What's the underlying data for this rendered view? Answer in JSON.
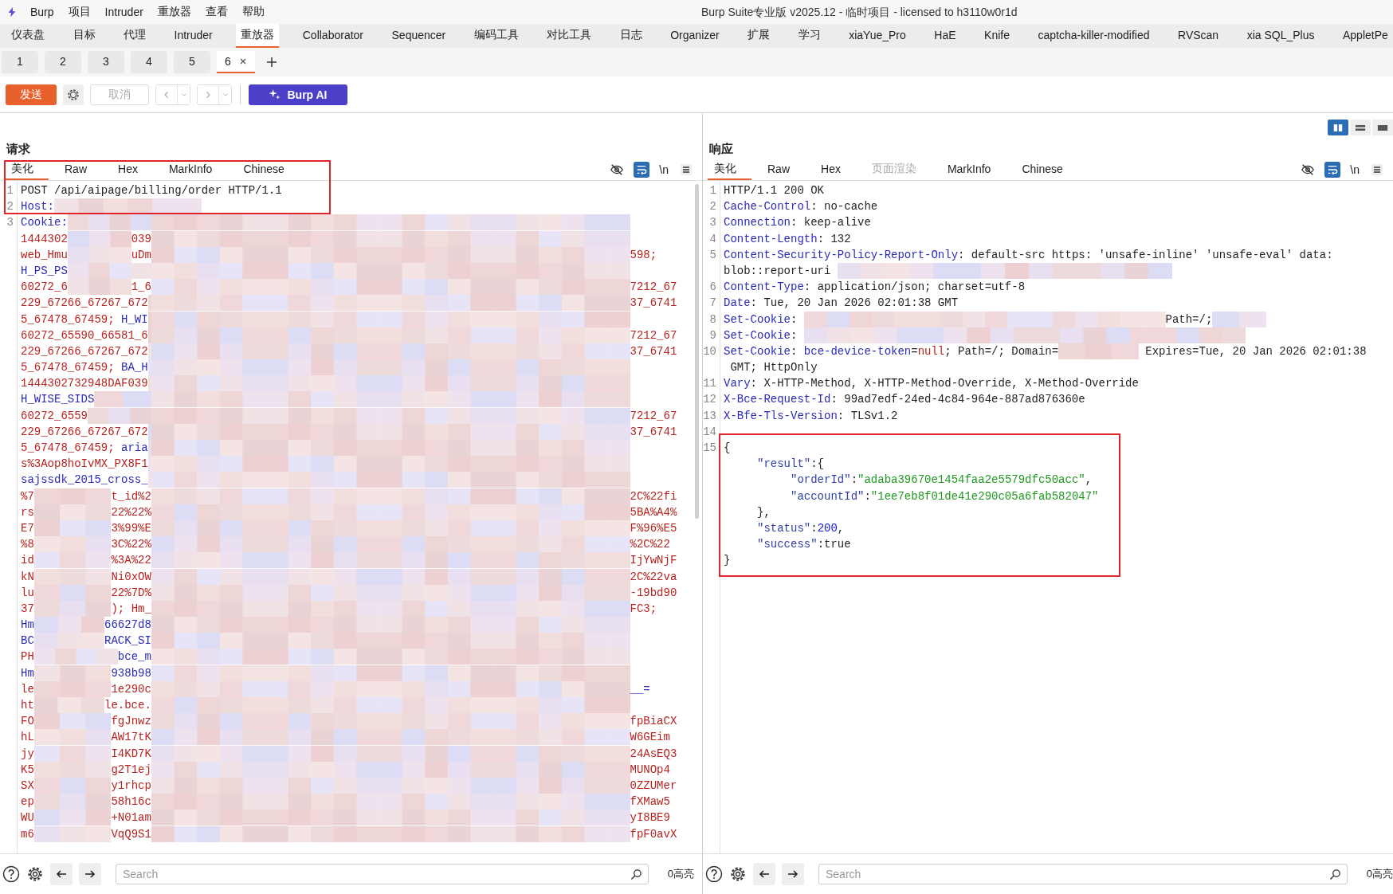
{
  "title_bar": {
    "menus": [
      "Burp",
      "项目",
      "Intruder",
      "重放器",
      "查看",
      "帮助"
    ],
    "title": "Burp Suite专业版  v2025.12 - 临时项目 - licensed to h3110w0r1d"
  },
  "main_tabs": [
    {
      "label": "仪表盘",
      "selected": false
    },
    {
      "label": "目标",
      "selected": false
    },
    {
      "label": "代理",
      "selected": false
    },
    {
      "label": "Intruder",
      "selected": false
    },
    {
      "label": "重放器",
      "selected": true
    },
    {
      "label": "Collaborator",
      "selected": false
    },
    {
      "label": "Sequencer",
      "selected": false
    },
    {
      "label": "编码工具",
      "selected": false
    },
    {
      "label": "对比工具",
      "selected": false
    },
    {
      "label": "日志",
      "selected": false
    },
    {
      "label": "Organizer",
      "selected": false
    },
    {
      "label": "扩展",
      "selected": false
    },
    {
      "label": "学习",
      "selected": false
    },
    {
      "label": "xiaYue_Pro",
      "selected": false
    },
    {
      "label": "HaE",
      "selected": false
    },
    {
      "label": "Knife",
      "selected": false
    },
    {
      "label": "captcha-killer-modified",
      "selected": false
    },
    {
      "label": "RVScan",
      "selected": false
    },
    {
      "label": "xia SQL_Plus",
      "selected": false
    },
    {
      "label": "AppletPe",
      "selected": false
    }
  ],
  "request_tabs": [
    {
      "label": "1",
      "selected": false
    },
    {
      "label": "2",
      "selected": false
    },
    {
      "label": "3",
      "selected": false
    },
    {
      "label": "4",
      "selected": false
    },
    {
      "label": "5",
      "selected": false
    },
    {
      "label": "6",
      "selected": true
    }
  ],
  "toolbar": {
    "send": "发送",
    "cancel": {
      "label": "取消",
      "disabled": true
    },
    "ai": "Burp AI"
  },
  "layout_toggles": [
    {
      "kind": "columns",
      "selected": true
    },
    {
      "kind": "rows",
      "selected": false
    },
    {
      "kind": "single",
      "selected": false
    }
  ],
  "request": {
    "title": "请求",
    "annotation_box": true,
    "wrap_on": true,
    "newline_label": "\\n",
    "tabs": [
      {
        "label": "美化",
        "selected": true,
        "disabled": false
      },
      {
        "label": "Raw",
        "selected": false,
        "disabled": false
      },
      {
        "label": "Hex",
        "selected": false,
        "disabled": false
      },
      {
        "label": "MarkInfo",
        "selected": false,
        "disabled": false
      },
      {
        "label": "Chinese",
        "selected": false,
        "disabled": false
      }
    ],
    "lines": [
      {
        "num": "1",
        "kind": "plain",
        "parts": [
          {
            "text": "POST /api/aipage/billing/order HTTP/1.1",
            "kind": "plain"
          }
        ]
      },
      {
        "num": "2",
        "kind": "short",
        "parts": [
          {
            "text": "Host:",
            "kind": "name"
          }
        ]
      },
      {
        "num": "3",
        "kind": "full",
        "parts": [
          {
            "text": "Cookie:",
            "kind": "name"
          }
        ]
      },
      {
        "kind": "full",
        "parts": [
          {
            "text": "1444302",
            "kind": "value"
          }
        ],
        "middle": {
          "text": "039",
          "kind": "value"
        }
      },
      {
        "kind": "full",
        "parts": [
          {
            "text": "web_Hmu",
            "kind": "value"
          }
        ],
        "middle": {
          "text": "uDm",
          "kind": "value"
        },
        "suffix": {
          "text": "598;",
          "kind": "value"
        }
      },
      {
        "kind": "full",
        "parts": [
          {
            "text": "H_PS_PS",
            "kind": "name"
          }
        ]
      },
      {
        "kind": "full",
        "parts": [
          {
            "text": "60272_6",
            "kind": "value"
          }
        ],
        "middle": {
          "text": "1_6",
          "kind": "value"
        },
        "suffix": {
          "text": "7212_67",
          "kind": "value"
        }
      },
      {
        "kind": "full",
        "parts": [
          {
            "text": "229_67266_67267_672",
            "kind": "value"
          }
        ],
        "suffix": {
          "text": "37_6741",
          "kind": "value"
        }
      },
      {
        "kind": "full",
        "parts": [
          {
            "text": "5_67478_67459; ",
            "kind": "value"
          },
          {
            "text": "H_WI",
            "kind": "name"
          }
        ]
      },
      {
        "kind": "full",
        "parts": [
          {
            "text": "60272_65590_66581_6",
            "kind": "value"
          }
        ],
        "suffix": {
          "text": "7212_67",
          "kind": "value"
        }
      },
      {
        "kind": "full",
        "parts": [
          {
            "text": "229_67266_67267_672",
            "kind": "value"
          }
        ],
        "suffix": {
          "text": "37_6741",
          "kind": "value"
        }
      },
      {
        "kind": "full",
        "parts": [
          {
            "text": "5_67478_67459; ",
            "kind": "value"
          },
          {
            "text": "BA_H",
            "kind": "name"
          }
        ]
      },
      {
        "kind": "full",
        "parts": [
          {
            "text": "1444302732948DAF039",
            "kind": "value"
          }
        ]
      },
      {
        "kind": "full",
        "parts": [
          {
            "text": "H_WISE_SIDS",
            "kind": "name"
          }
        ]
      },
      {
        "kind": "full",
        "parts": [
          {
            "text": "60272_6559",
            "kind": "value"
          }
        ],
        "suffix": {
          "text": "7212_67",
          "kind": "value"
        }
      },
      {
        "kind": "full",
        "parts": [
          {
            "text": "229_67266_67267_672",
            "kind": "value"
          }
        ],
        "suffix": {
          "text": "37_6741",
          "kind": "value"
        }
      },
      {
        "kind": "full",
        "parts": [
          {
            "text": "5_67478_67459; ",
            "kind": "value"
          },
          {
            "text": "aria",
            "kind": "name"
          }
        ]
      },
      {
        "kind": "full",
        "parts": [
          {
            "text": "s%3Aop8hoIvMX_PX8F1",
            "kind": "value"
          }
        ]
      },
      {
        "kind": "full",
        "parts": [
          {
            "text": "sajssdk_2015_cross_",
            "kind": "name"
          }
        ]
      },
      {
        "kind": "full",
        "parts": [
          {
            "text": "%7",
            "kind": "value"
          }
        ],
        "middle": {
          "text": "t_id%2",
          "kind": "value"
        },
        "suffix": {
          "text": "2C%22fi",
          "kind": "value"
        }
      },
      {
        "kind": "full",
        "parts": [
          {
            "text": "rs",
            "kind": "value"
          }
        ],
        "middle": {
          "text": "22%22%",
          "kind": "value"
        },
        "suffix": {
          "text": "5BA%A4%",
          "kind": "value"
        }
      },
      {
        "kind": "full",
        "parts": [
          {
            "text": "E7",
            "kind": "value"
          }
        ],
        "middle": {
          "text": "3%99%E",
          "kind": "value"
        },
        "suffix": {
          "text": "F%96%E5",
          "kind": "value"
        }
      },
      {
        "kind": "full",
        "parts": [
          {
            "text": "%8",
            "kind": "value"
          }
        ],
        "middle": {
          "text": "3C%22%",
          "kind": "value"
        },
        "suffix": {
          "text": "%2C%22",
          "kind": "value"
        }
      },
      {
        "kind": "full",
        "parts": [
          {
            "text": "id",
            "kind": "value"
          }
        ],
        "middle": {
          "text": "%3A%22",
          "kind": "value"
        },
        "suffix": {
          "text": "IjYwNjF",
          "kind": "value"
        }
      },
      {
        "kind": "full",
        "parts": [
          {
            "text": "kN",
            "kind": "value"
          }
        ],
        "middle": {
          "text": "Ni0xOW",
          "kind": "value"
        },
        "suffix": {
          "text": "2C%22va",
          "kind": "value"
        }
      },
      {
        "kind": "full",
        "parts": [
          {
            "text": "lu",
            "kind": "value"
          }
        ],
        "middle": {
          "text": "22%7D%",
          "kind": "value"
        },
        "suffix": {
          "text": "-19bd90",
          "kind": "value"
        }
      },
      {
        "kind": "full",
        "parts": [
          {
            "text": "37",
            "kind": "value"
          }
        ],
        "middle": {
          "text": "); Hm_",
          "kind": "value"
        },
        "suffix": {
          "text": "FC3;",
          "kind": "value"
        }
      },
      {
        "kind": "full",
        "parts": [
          {
            "text": "Hm",
            "kind": "name"
          }
        ],
        "middle": {
          "text": "66627d8",
          "kind": "name"
        }
      },
      {
        "kind": "full",
        "parts": [
          {
            "text": "BC",
            "kind": "name"
          }
        ],
        "middle": {
          "text": "RACK_SI",
          "kind": "name"
        }
      },
      {
        "kind": "full",
        "parts": [
          {
            "text": "PH",
            "kind": "value"
          }
        ],
        "middle": {
          "text": "bce_m",
          "kind": "name"
        }
      },
      {
        "kind": "full",
        "parts": [
          {
            "text": "Hm",
            "kind": "name"
          }
        ],
        "middle": {
          "text": "938b98",
          "kind": "name"
        }
      },
      {
        "kind": "full",
        "parts": [
          {
            "text": "le",
            "kind": "value"
          }
        ],
        "middle": {
          "text": "1e290c",
          "kind": "value"
        },
        "suffix": {
          "text": "__=",
          "kind": "name"
        }
      },
      {
        "kind": "full",
        "parts": [
          {
            "text": "ht",
            "kind": "value"
          }
        ],
        "middle": {
          "text": "le.bce.",
          "kind": "value"
        }
      },
      {
        "kind": "full",
        "parts": [
          {
            "text": "FO",
            "kind": "value"
          }
        ],
        "middle": {
          "text": "fgJnwz",
          "kind": "value"
        },
        "suffix": {
          "text": "fpBiaCX",
          "kind": "value"
        }
      },
      {
        "kind": "full",
        "parts": [
          {
            "text": "hL",
            "kind": "value"
          }
        ],
        "middle": {
          "text": "AW17tK",
          "kind": "value"
        },
        "suffix": {
          "text": "W6GEim",
          "kind": "value"
        }
      },
      {
        "kind": "full",
        "parts": [
          {
            "text": "jy",
            "kind": "value"
          }
        ],
        "middle": {
          "text": "I4KD7K",
          "kind": "value"
        },
        "suffix": {
          "text": "24AsEQ3",
          "kind": "value"
        }
      },
      {
        "kind": "full",
        "parts": [
          {
            "text": "K5",
            "kind": "value"
          }
        ],
        "middle": {
          "text": "g2T1ej",
          "kind": "value"
        },
        "suffix": {
          "text": "MUNOp4",
          "kind": "value"
        }
      },
      {
        "kind": "full",
        "parts": [
          {
            "text": "SX",
            "kind": "value"
          }
        ],
        "middle": {
          "text": "y1rhcp",
          "kind": "value"
        },
        "suffix": {
          "text": "0ZZUMer",
          "kind": "value"
        }
      },
      {
        "kind": "full",
        "parts": [
          {
            "text": "ep",
            "kind": "value"
          }
        ],
        "middle": {
          "text": "58h16c",
          "kind": "value"
        },
        "suffix": {
          "text": "fXMaw5",
          "kind": "value"
        }
      },
      {
        "kind": "full",
        "parts": [
          {
            "text": "WU",
            "kind": "value"
          }
        ],
        "middle": {
          "text": "+N01am",
          "kind": "value"
        },
        "suffix": {
          "text": "yI8BE9",
          "kind": "value"
        }
      },
      {
        "kind": "full",
        "parts": [
          {
            "text": "m6",
            "kind": "value"
          }
        ],
        "middle": {
          "text": "VqQ9S1",
          "kind": "value"
        },
        "suffix": {
          "text": "fpF0avX",
          "kind": "value"
        }
      }
    ],
    "search": {
      "placeholder": "Search"
    },
    "highlights": "0高亮"
  },
  "response": {
    "title": "响应",
    "annotation_box": true,
    "wrap_on": true,
    "newline_label": "\\n",
    "tabs": [
      {
        "label": "美化",
        "selected": true,
        "disabled": false
      },
      {
        "label": "Raw",
        "selected": false,
        "disabled": false
      },
      {
        "label": "Hex",
        "selected": false,
        "disabled": false
      },
      {
        "label": "页面渲染",
        "selected": false,
        "disabled": true
      },
      {
        "label": "MarkInfo",
        "selected": false,
        "disabled": false
      },
      {
        "label": "Chinese",
        "selected": false,
        "disabled": false
      }
    ],
    "lines": [
      {
        "num": "1",
        "parts": [
          {
            "text": "HTTP/1.1 200 OK",
            "kind": "plain"
          }
        ]
      },
      {
        "num": "2",
        "parts": [
          {
            "text": "Cache-Control",
            "kind": "name"
          },
          {
            "text": ": no-cache",
            "kind": "plain"
          }
        ]
      },
      {
        "num": "3",
        "parts": [
          {
            "text": "Connection",
            "kind": "name"
          },
          {
            "text": ": keep-alive",
            "kind": "plain"
          }
        ]
      },
      {
        "num": "4",
        "parts": [
          {
            "text": "Content-Length",
            "kind": "name"
          },
          {
            "text": ": 132",
            "kind": "plain"
          }
        ]
      },
      {
        "num": "5",
        "parts": [
          {
            "text": "Content-Security-Policy-Report-Only",
            "kind": "name"
          },
          {
            "text": ": default-src https: 'unsafe-inline' 'unsafe-eval' data:",
            "kind": "plain"
          }
        ]
      },
      {
        "parts": [
          {
            "text": "blob::report-uri ",
            "kind": "plain"
          },
          {
            "kind": "long"
          }
        ]
      },
      {
        "num": "6",
        "parts": [
          {
            "text": "Content-Type",
            "kind": "name"
          },
          {
            "text": ": application/json; charset=utf-8",
            "kind": "plain"
          }
        ]
      },
      {
        "num": "7",
        "parts": [
          {
            "text": "Date",
            "kind": "name"
          },
          {
            "text": ": Tue, 20 Jan 2026 02:01:38 GMT",
            "kind": "plain"
          }
        ]
      },
      {
        "num": "8",
        "parts": [
          {
            "text": "Set-Cookie",
            "kind": "name"
          },
          {
            "text": ": ",
            "kind": "plain"
          },
          {
            "kind": "medium"
          },
          {
            "text": "Path=/;",
            "kind": "plain"
          },
          {
            "kind": "tiny"
          }
        ]
      },
      {
        "num": "9",
        "parts": [
          {
            "text": "Set-Cookie",
            "kind": "name"
          },
          {
            "text": ": ",
            "kind": "plain"
          },
          {
            "kind": "wide"
          }
        ]
      },
      {
        "num": "10",
        "parts": [
          {
            "text": "Set-Cookie",
            "kind": "name"
          },
          {
            "text": ": ",
            "kind": "plain"
          },
          {
            "text": "bce-device-token",
            "kind": "name"
          },
          {
            "text": "=",
            "kind": "plain"
          },
          {
            "text": "null",
            "kind": "value"
          },
          {
            "text": "; Path=/; Domain=",
            "kind": "plain"
          },
          {
            "kind": "short"
          },
          {
            "text": " Expires=Tue, 20 Jan 2026 02:01:38",
            "kind": "plain"
          }
        ]
      },
      {
        "parts": [
          {
            "text": " GMT; HttpOnly",
            "kind": "plain"
          }
        ]
      },
      {
        "num": "11",
        "parts": [
          {
            "text": "Vary",
            "kind": "name"
          },
          {
            "text": ": X-HTTP-Method, X-HTTP-Method-Override, X-Method-Override",
            "kind": "plain"
          }
        ]
      },
      {
        "num": "12",
        "parts": [
          {
            "text": "X-Bce-Request-Id",
            "kind": "name"
          },
          {
            "text": ": 99ad7edf-24ed-4c84-964e-887ad876360e",
            "kind": "plain"
          }
        ]
      },
      {
        "num": "13",
        "parts": [
          {
            "text": "X-Bfe-Tls-Version",
            "kind": "name"
          },
          {
            "text": ": TLSv1.2",
            "kind": "plain"
          }
        ]
      },
      {
        "num": "14"
      },
      {
        "num": "15",
        "parts": [
          {
            "text": "{",
            "kind": "plain"
          }
        ]
      },
      {
        "parts": [
          {
            "text": "     \"result\"",
            "kind": "key"
          },
          {
            "text": ":{",
            "kind": "plain"
          }
        ]
      },
      {
        "parts": [
          {
            "text": "          \"orderId\"",
            "kind": "key"
          },
          {
            "text": ":",
            "kind": "plain"
          },
          {
            "text": "\"adaba39670e1454faa2e5579dfc50acc\"",
            "kind": "string"
          },
          {
            "text": ",",
            "kind": "plain"
          }
        ]
      },
      {
        "parts": [
          {
            "text": "          \"accountId\"",
            "kind": "key"
          },
          {
            "text": ":",
            "kind": "plain"
          },
          {
            "text": "\"1ee7eb8f01de41e290c05a6fab582047\"",
            "kind": "string"
          }
        ]
      },
      {
        "parts": [
          {
            "text": "     },",
            "kind": "plain"
          }
        ]
      },
      {
        "parts": [
          {
            "text": "     \"status\"",
            "kind": "key"
          },
          {
            "text": ":",
            "kind": "plain"
          },
          {
            "text": "200",
            "kind": "number"
          },
          {
            "text": ",",
            "kind": "plain"
          }
        ]
      },
      {
        "parts": [
          {
            "text": "     \"success\"",
            "kind": "key"
          },
          {
            "text": ":true",
            "kind": "plain"
          }
        ]
      },
      {
        "parts": [
          {
            "text": "}",
            "kind": "plain"
          }
        ]
      }
    ],
    "search": {
      "placeholder": "Search"
    },
    "highlights": "0高亮"
  }
}
